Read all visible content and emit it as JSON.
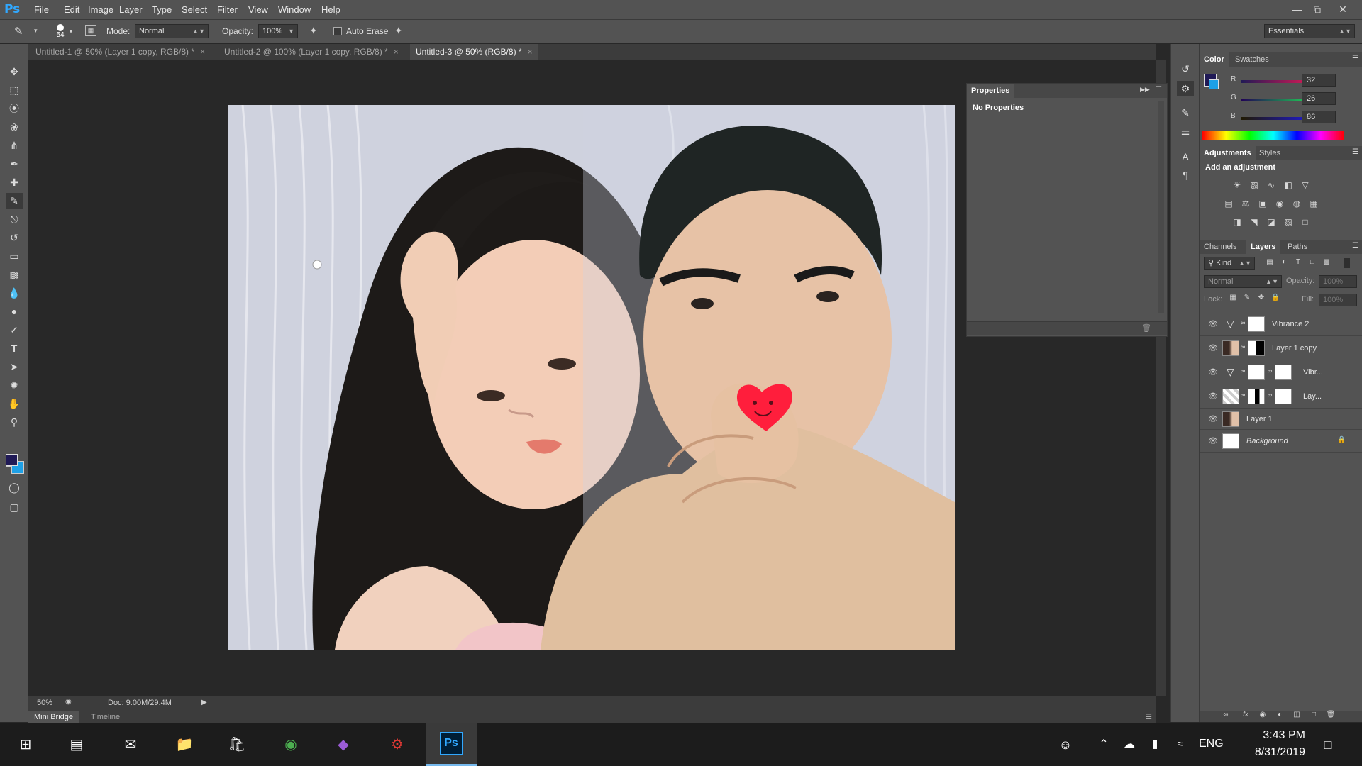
{
  "app": {
    "logo": "Ps"
  },
  "menu": [
    "File",
    "Edit",
    "Image",
    "Layer",
    "Type",
    "Select",
    "Filter",
    "View",
    "Window",
    "Help"
  ],
  "options": {
    "brush_size": "54",
    "mode_label": "Mode:",
    "mode_value": "Normal",
    "opacity_label": "Opacity:",
    "opacity_value": "100%",
    "auto_erase_label": "Auto Erase",
    "workspace": "Essentials"
  },
  "doc_tabs": [
    {
      "label": "Untitled-1 @ 50% (Layer 1 copy, RGB/8) *"
    },
    {
      "label": "Untitled-2 @ 100% (Layer 1 copy, RGB/8) *"
    },
    {
      "label": "Untitled-3 @ 50% (RGB/8) *"
    }
  ],
  "status": {
    "zoom": "50%",
    "doc": "Doc: 9.00M/29.4M"
  },
  "bottom_tabs": [
    "Mini Bridge",
    "Timeline"
  ],
  "properties": {
    "title": "Properties",
    "content": "No Properties"
  },
  "color_panel": {
    "tabs": [
      "Color",
      "Swatches"
    ],
    "r_label": "R",
    "g_label": "G",
    "b_label": "B",
    "r": "32",
    "g": "26",
    "b": "86",
    "foreground": "#201a56",
    "background": "#1ea0e6"
  },
  "adjustments": {
    "tabs": [
      "Adjustments",
      "Styles"
    ],
    "heading": "Add an adjustment"
  },
  "layers_panel": {
    "tabs": [
      "Channels",
      "Layers",
      "Paths"
    ],
    "kind": "Kind",
    "blend": "Normal",
    "opacity_label": "Opacity:",
    "opacity": "100%",
    "lock_label": "Lock:",
    "fill_label": "Fill:",
    "fill": "100%",
    "layers": [
      {
        "name": "Vibrance 2"
      },
      {
        "name": "Layer 1 copy"
      },
      {
        "name": "Vibr..."
      },
      {
        "name": "Lay..."
      },
      {
        "name": "Layer 1"
      },
      {
        "name": "Background"
      }
    ]
  },
  "taskbar": {
    "lang": "ENG",
    "time": "3:43 PM",
    "date": "8/31/2019"
  }
}
